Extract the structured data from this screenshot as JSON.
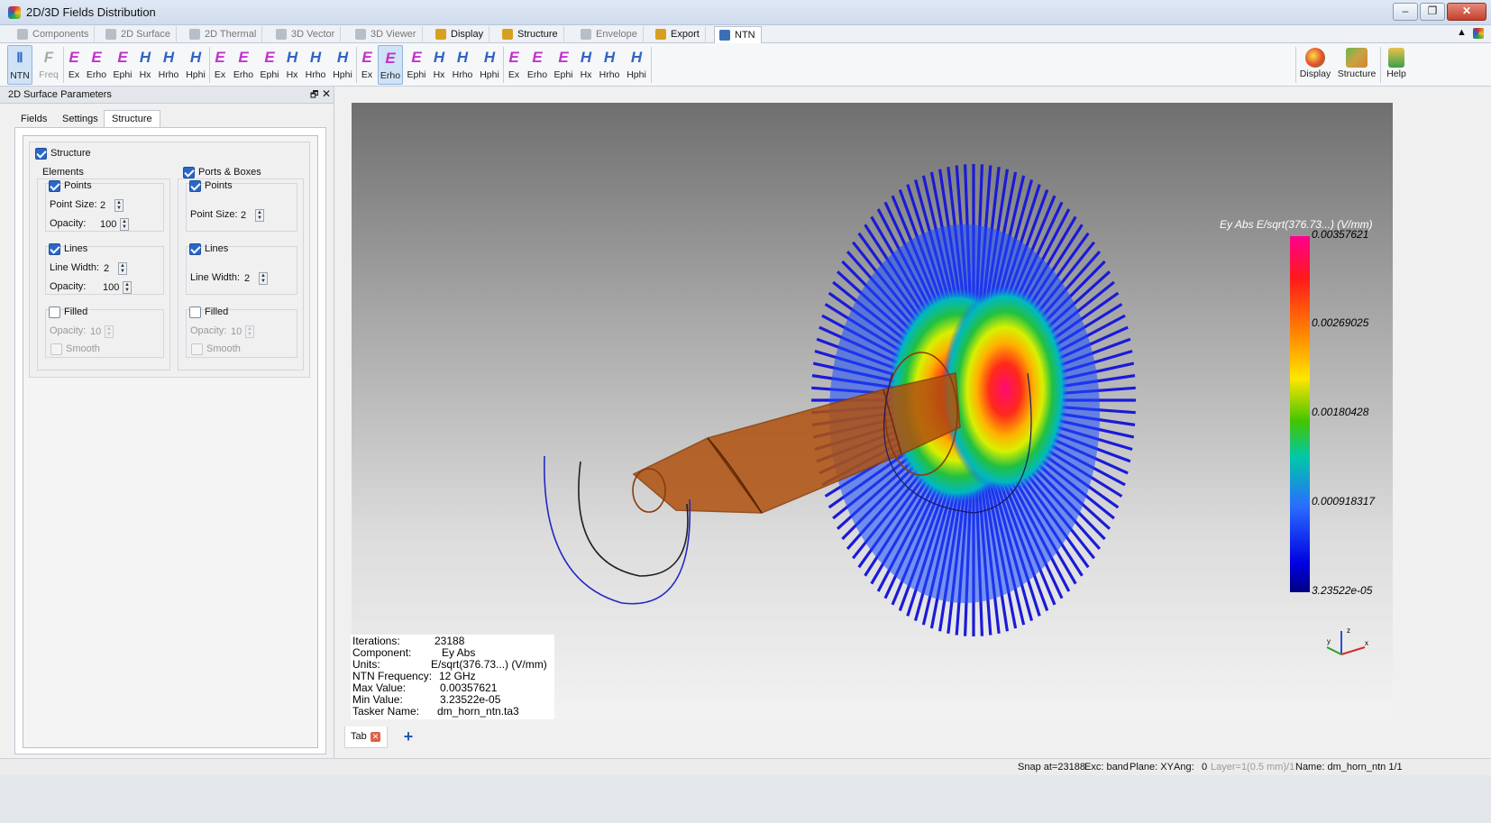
{
  "window": {
    "title": "2D/3D Fields Distribution",
    "controls": {
      "minimize": "–",
      "maximize": "❐",
      "close": "✕"
    }
  },
  "ribbon_tabs": [
    {
      "label": "Components",
      "state": "disabled"
    },
    {
      "label": "2D Surface",
      "state": "disabled"
    },
    {
      "label": "2D Thermal",
      "state": "disabled"
    },
    {
      "label": "3D Vector",
      "state": "disabled"
    },
    {
      "label": "3D Viewer",
      "state": "disabled"
    },
    {
      "label": "Display",
      "state": "enabled"
    },
    {
      "label": "Structure",
      "state": "enabled"
    },
    {
      "label": "Envelope",
      "state": "disabled"
    },
    {
      "label": "Export",
      "state": "enabled"
    },
    {
      "label": "NTN",
      "state": "selected"
    }
  ],
  "ribbon_pin": "▲",
  "toolbar": {
    "ntn": "NTN",
    "freq": "Freq",
    "groups": [
      {
        "type": "R",
        "items": [
          "Ex",
          "Erho",
          "Ephi",
          "Hx",
          "Hrho",
          "Hphi"
        ]
      },
      {
        "type": "L",
        "items": [
          "Ex",
          "Erho",
          "Ephi",
          "Hx",
          "Hrho",
          "Hphi"
        ]
      },
      {
        "type": "M",
        "items": [
          "Ex",
          "Erho",
          "Ephi",
          "Hx",
          "Hrho",
          "Hphi"
        ]
      },
      {
        "type": "A",
        "items": [
          "Ex",
          "Erho",
          "Ephi",
          "Hx",
          "Hrho",
          "Hphi"
        ]
      }
    ],
    "selected": "Erho (M)",
    "right": [
      "Display",
      "Structure",
      "Help"
    ]
  },
  "left_panel": {
    "title": "2D Surface Parameters",
    "float_icon": "🗗",
    "close_icon": "✕",
    "tabs": [
      "Fields",
      "Settings",
      "Structure"
    ],
    "active_tab": "Structure",
    "structure": {
      "label": "Structure",
      "checked": true
    },
    "elements": {
      "label": "Elements",
      "points": {
        "label": "Points",
        "checked": true,
        "point_size_label": "Point Size:",
        "point_size": "2",
        "opacity_label": "Opacity:",
        "opacity": "100"
      },
      "lines": {
        "label": "Lines",
        "checked": true,
        "line_width_label": "Line Width:",
        "line_width": "2",
        "opacity_label": "Opacity:",
        "opacity": "100"
      },
      "filled": {
        "label": "Filled",
        "checked": false,
        "opacity_label": "Opacity:",
        "opacity": "10",
        "smooth_label": "Smooth"
      }
    },
    "ports": {
      "label": "Ports & Boxes",
      "checked": true,
      "points": {
        "label": "Points",
        "checked": true,
        "point_size_label": "Point Size:",
        "point_size": "2"
      },
      "lines": {
        "label": "Lines",
        "checked": true,
        "line_width_label": "Line Width:",
        "line_width": "2"
      },
      "filled": {
        "label": "Filled",
        "checked": false,
        "opacity_label": "Opacity:",
        "opacity": "10",
        "smooth_label": "Smooth"
      }
    }
  },
  "viewport": {
    "colorbar": {
      "title": "Ey Abs E/sqrt(376.73...) (V/mm)",
      "ticks": [
        "0.00357621",
        "0.00269025",
        "0.00180428",
        "0.000918317",
        "3.23522e-05"
      ]
    },
    "axes": {
      "x": "x",
      "y": "y",
      "z": "z"
    },
    "info": [
      {
        "label": "Iterations:",
        "value": "23188"
      },
      {
        "label": "Component:",
        "value": "Ey Abs"
      },
      {
        "label": "Units:",
        "value": "E/sqrt(376.73...) (V/mm)"
      },
      {
        "label": "NTN Frequency:",
        "value": "12 GHz"
      },
      {
        "label": "Max Value:",
        "value": "0.00357621"
      },
      {
        "label": "Min Value:",
        "value": "3.23522e-05"
      },
      {
        "label": "Tasker Name:",
        "value": "dm_horn_ntn.ta3"
      }
    ],
    "bottom_tab": "Tab",
    "add_tab": "+"
  },
  "statusbar": {
    "snap": "Snap at=23188",
    "exc": "Exc: band",
    "plane": "Plane: XY",
    "ang": "Ang:",
    "ang_value": "0",
    "layer": "Layer=1(0.5 mm)/1",
    "name": "Name: dm_horn_ntn 1/1"
  }
}
